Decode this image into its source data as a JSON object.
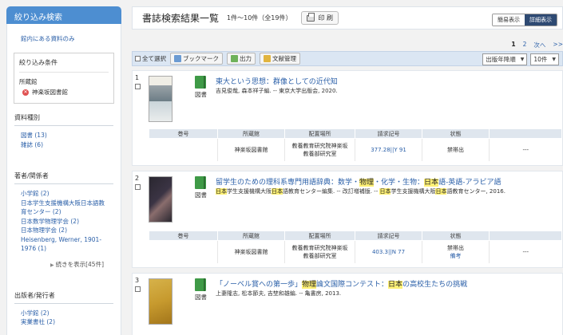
{
  "sidebar": {
    "narrow_title": "絞り込み検索",
    "in_library_link": "館内にある資料のみ",
    "conditions": {
      "title": "絞り込み条件",
      "key": "所蔵館",
      "value": "神楽坂図書館"
    },
    "facets": [
      {
        "title": "資料種別",
        "items": [
          "図書 (13)",
          "雑誌 (6)"
        ]
      },
      {
        "title": "著者/関係者",
        "items": [
          "小学館 (2)",
          "日本学生支援機構大阪日本語教",
          "育センター (2)",
          "日本数学物理学会 (2)",
          "日本物理学会 (2)",
          "Heisenberg, Werner, 1901-",
          "1976 (1)"
        ],
        "more": "続きを表示[45件]"
      },
      {
        "title": "出版者/発行者",
        "items": [
          "小学館 (2)",
          "実業書社 (2)"
        ]
      }
    ]
  },
  "header": {
    "title": "書誌検索結果一覧",
    "count": "1件～10件（全19件）",
    "print_label": "印 刷",
    "view_simple": "簡易表示",
    "view_detail": "詳細表示"
  },
  "pager": {
    "current": "1",
    "next_page": "2",
    "next_label": "次へ",
    "last_label": ">>"
  },
  "toolbar": {
    "select_all": "全て選択",
    "bookmark": "ブックマーク",
    "output": "出力",
    "bibliography": "文献管理",
    "sort": "出版年降順",
    "per_page": "10件"
  },
  "holding_headers": [
    "巻号",
    "所蔵館",
    "配置場所",
    "請求記号",
    "状態",
    ""
  ],
  "records": [
    {
      "num": "1",
      "type": "図書",
      "title_parts": [
        "東大という思想：群像としての近代知"
      ],
      "meta": "吉見俊哉, 森本祥子編. -- 東京大学出版会, 2020.",
      "holding": {
        "location": "神楽坂図書館",
        "place": [
          "教養教育研究院神楽坂",
          "教養部研究室"
        ],
        "callno": "377.28||Y 91",
        "status": "禁帯出",
        "note": "",
        "extra": "---"
      }
    },
    {
      "num": "2",
      "type": "図書",
      "title_parts": [
        "留学生のための理科系専門用語辞典：数学・",
        "物理",
        "・化学・生物：",
        "日本",
        "語-英語-アラビア語"
      ],
      "meta_parts": [
        "日本",
        "学生支援機構大阪",
        "日本",
        "語教育センター編集. -- 改訂増補版. -- ",
        "日本",
        "学生支援機構大阪",
        "日本",
        "語教育センター, 2016."
      ],
      "holding": {
        "location": "神楽坂図書館",
        "place": [
          "教養教育研究院神楽坂",
          "教養部研究室"
        ],
        "callno": "403.3||N 77",
        "status": "禁帯出",
        "note": "備考",
        "extra": "---"
      }
    },
    {
      "num": "3",
      "type": "図書",
      "title_parts": [
        "「ノーベル賞への第一歩」",
        "物理",
        "論文国際コンテスト：",
        "日本",
        "の高校生たちの挑戦"
      ],
      "meta": "上妻隆志, 松本節夫, 吉埜和雄編. -- 亀書房, 2013."
    }
  ],
  "colors": {
    "accent": "#4d8ed1",
    "highlight": "#fff176",
    "book_green": "#3f9a47",
    "detail_btn": "#2e4a73"
  }
}
